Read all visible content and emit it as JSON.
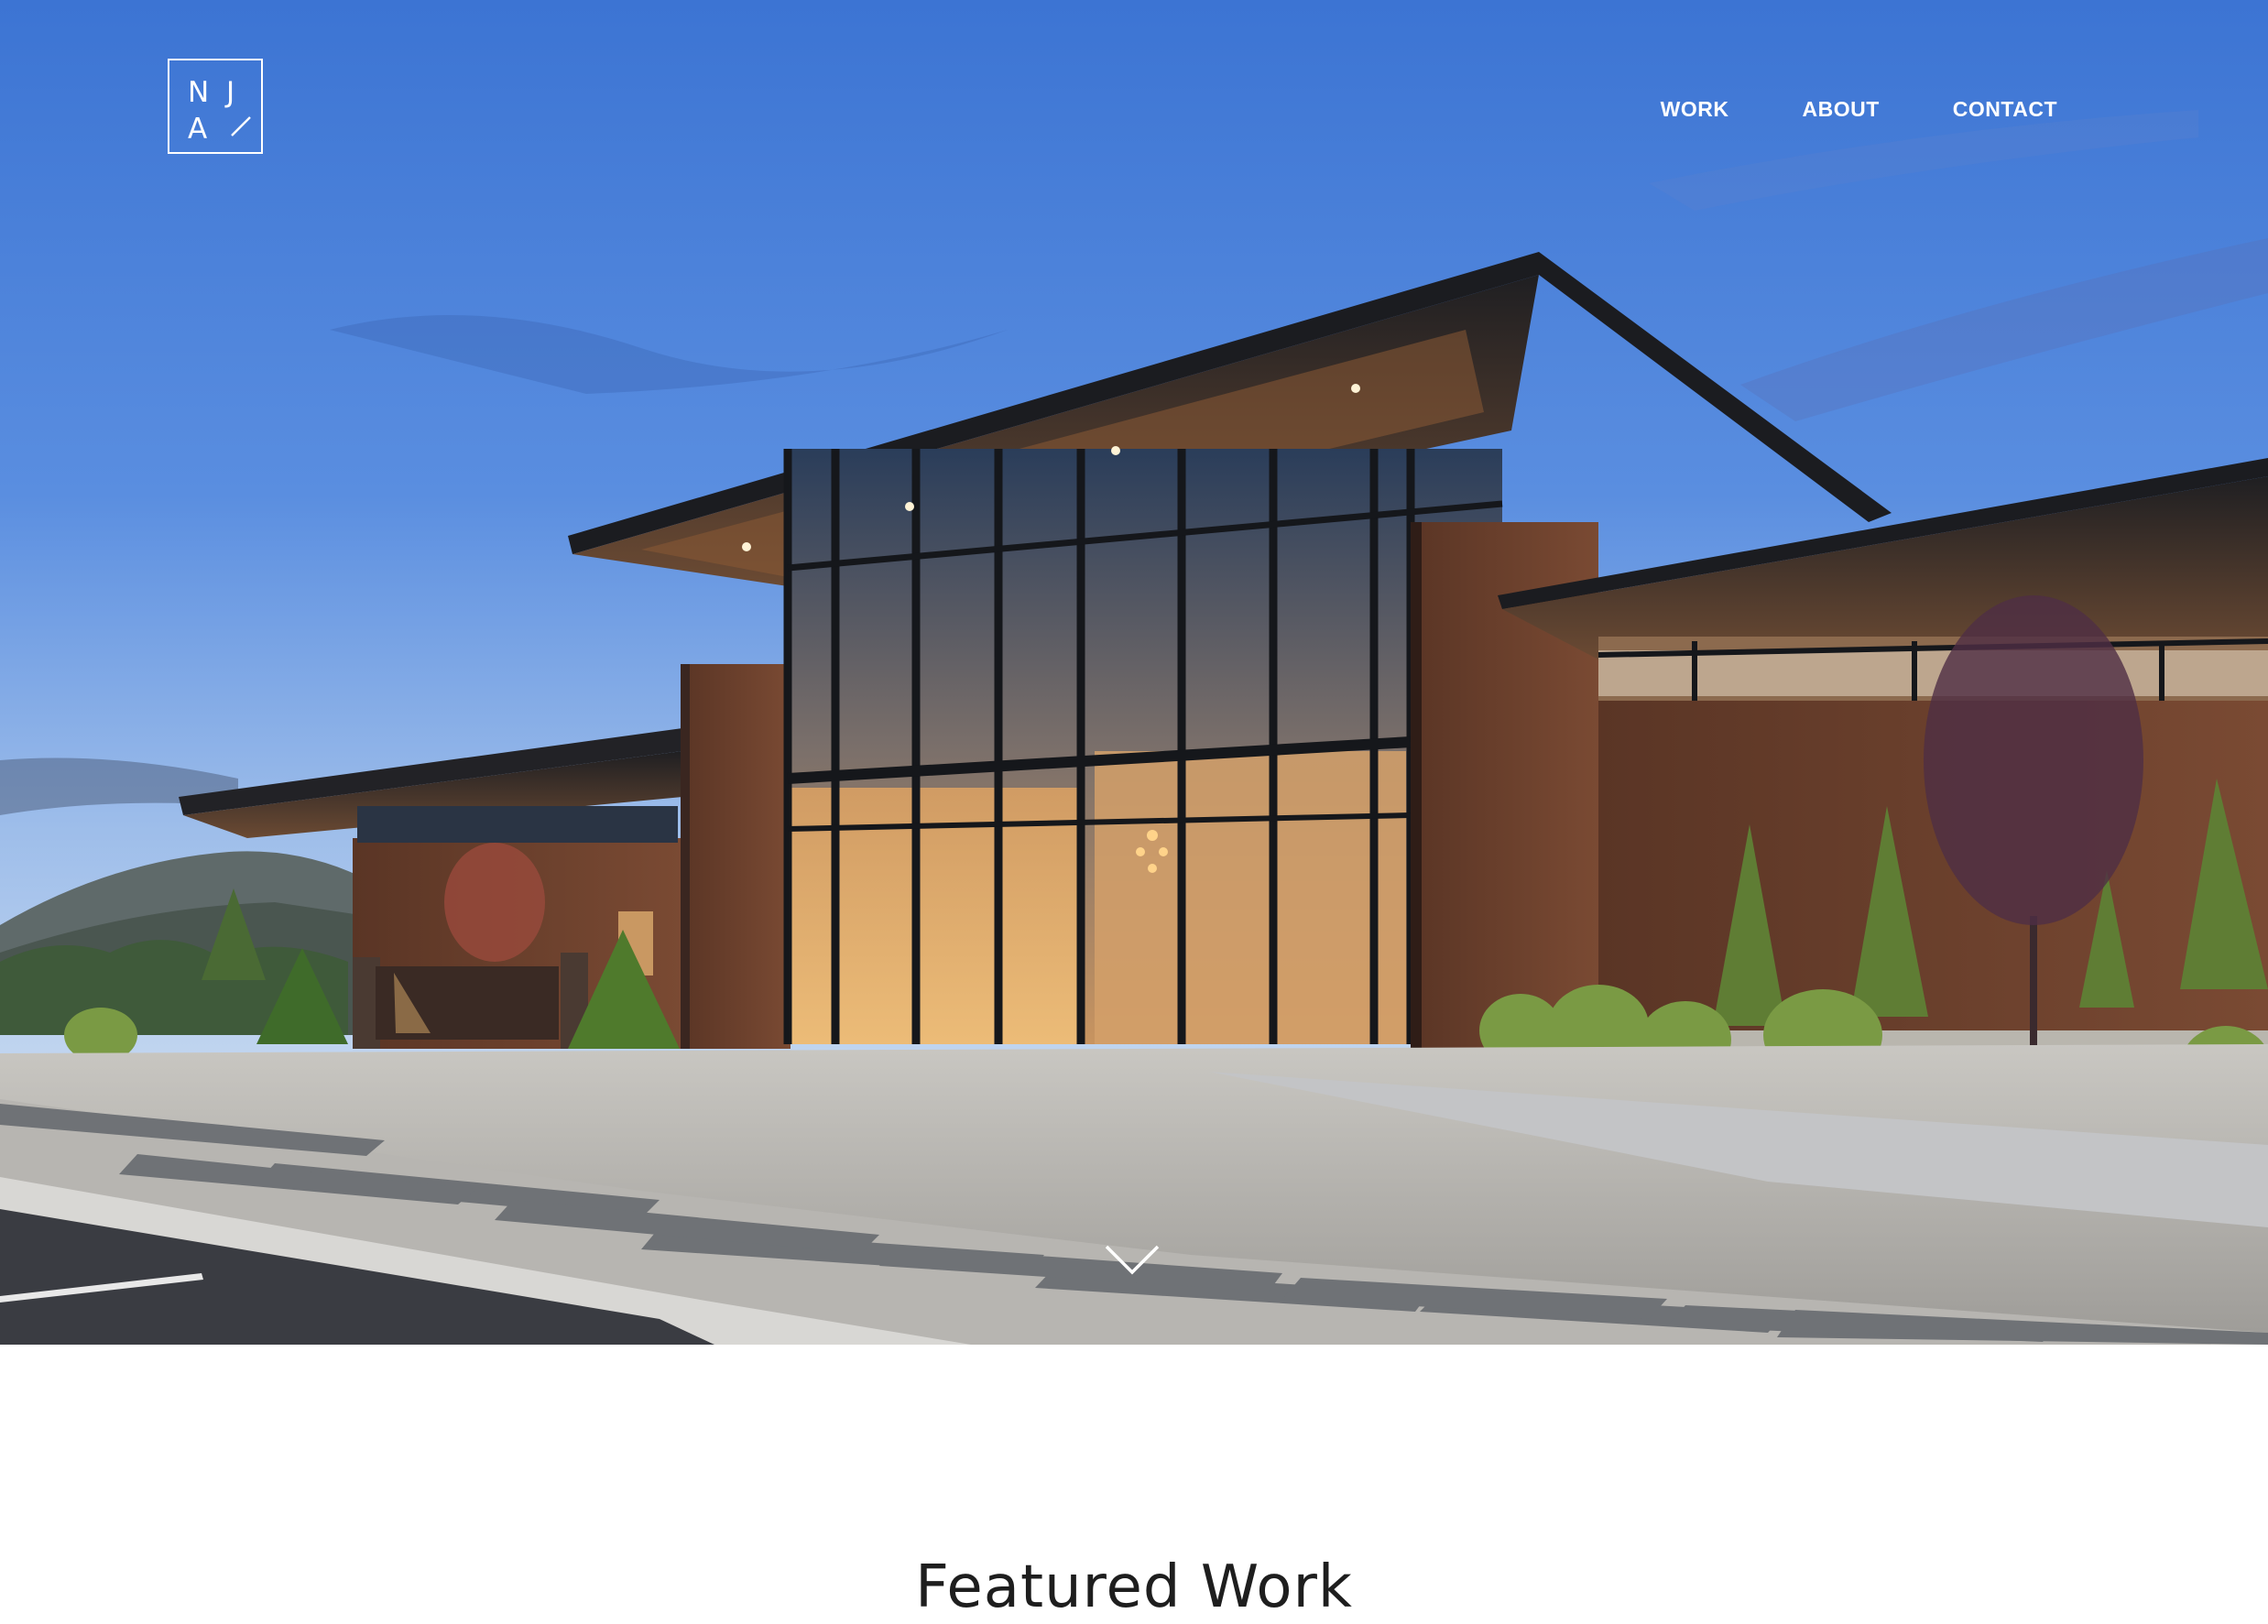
{
  "brand": {
    "logo_letters": [
      "N",
      "J",
      "A"
    ]
  },
  "nav": {
    "items": [
      {
        "label": "WORK"
      },
      {
        "label": "ABOUT"
      },
      {
        "label": "CONTACT"
      }
    ]
  },
  "hero": {
    "scroll_icon": "chevron-down-icon"
  },
  "featured": {
    "title": "Featured Work"
  },
  "colors": {
    "nav_text": "#ffffff",
    "sky_top": "#3f79d6",
    "sky_horizon": "#a9c6ec",
    "corten": "#6b3f2a",
    "title_text": "#1e1e1e"
  }
}
